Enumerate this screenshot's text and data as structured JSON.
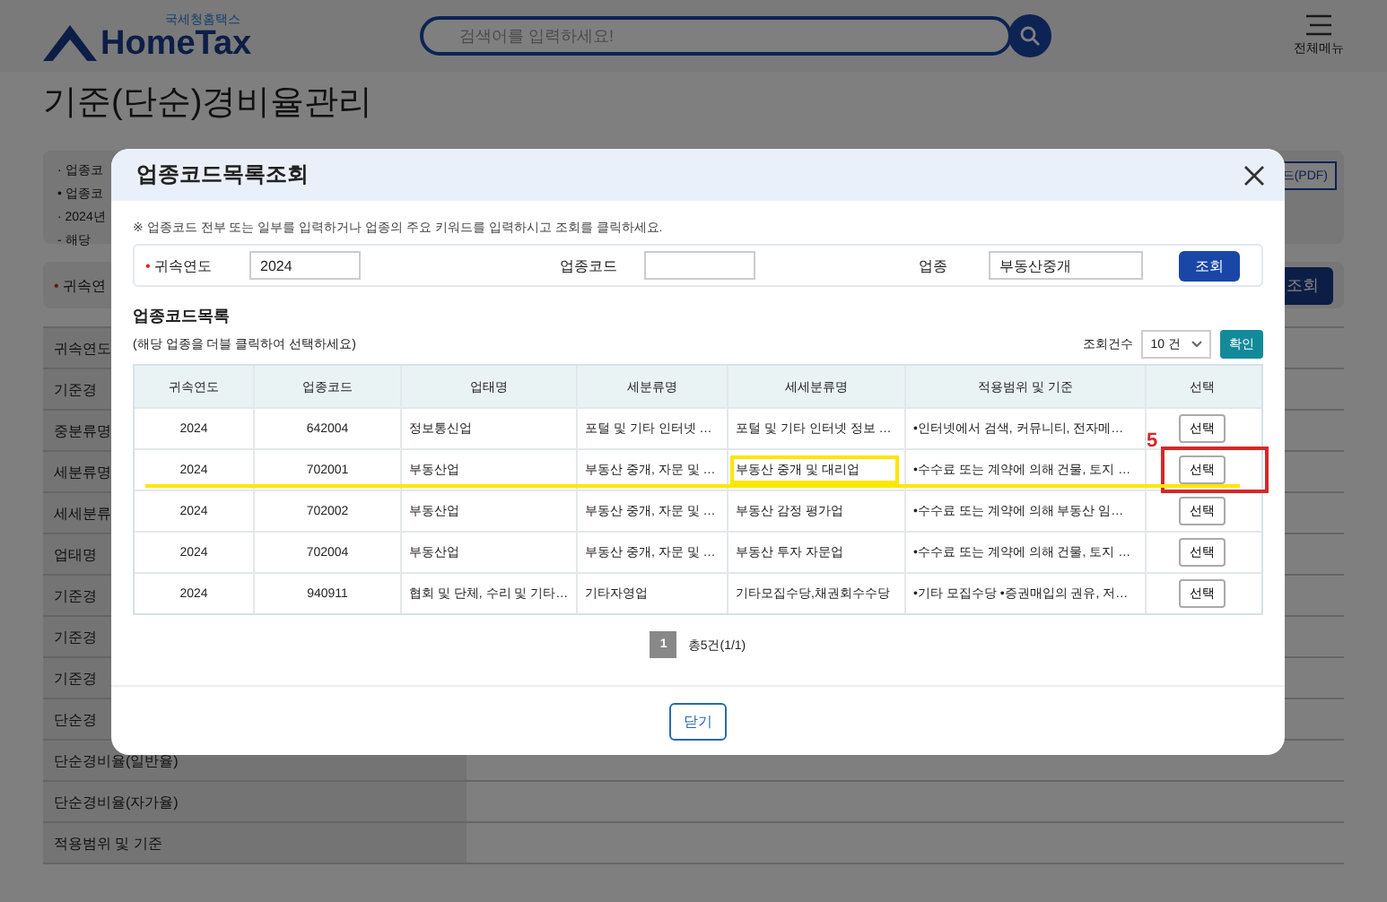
{
  "header": {
    "logo_sub": "국세청홈택스",
    "logo": "HomeTax",
    "search_placeholder": "검색어를 입력하세요!",
    "menu_label": "전체메뉴"
  },
  "page": {
    "title": "기준(단순)경비율관리",
    "info_lines": [
      "· 업종코",
      "• 업종코",
      "· 2024년",
      "- 해당"
    ],
    "pdf_button": "드(PDF)",
    "filter_marker": "•",
    "filter_label": "귀속연",
    "search_button": "조회",
    "table_labels": [
      "귀속연도",
      "기준경",
      "중분류명",
      "세분류명",
      "세세분류",
      "업태명",
      "기준경",
      "기준경",
      "기준경",
      "단순경",
      "단순경비율(일반율)",
      "단순경비율(자가율)",
      "적용범위 및 기준"
    ]
  },
  "modal": {
    "title": "업종코드목록조회",
    "note": "※ 업종코드 전부 또는 일부를 입력하거나 업종의 주요 키워드를 입력하시고 조회를 클릭하세요.",
    "fields": [
      {
        "marker": "•",
        "label": "귀속연도",
        "value": "2024"
      },
      {
        "label": "업종코드"
      },
      {
        "label": "업종",
        "value": "부동산중개"
      }
    ],
    "search_button": "조회",
    "list_title": "업종코드목록",
    "list_hint": "(해당 업종을 더블 클릭하여 선택하세요)",
    "count_label": "조회건수",
    "count_select": "10 건",
    "confirm_button": "확인",
    "columns": [
      "귀속연도",
      "업종코드",
      "업태명",
      "세분류명",
      "세세분류명",
      "적용범위 및 기준",
      "선택"
    ],
    "rows": [
      {
        "cells": [
          "2024",
          "642004",
          "정보통신업",
          "포털 및 기타 인터넷 …",
          "포털 및 기타 인터넷 정보 …",
          "•인터넷에서 검색, 커뮤니티, 전자메…"
        ],
        "button": "선택"
      },
      {
        "cells": [
          "2024",
          "702001",
          "부동산업",
          "부동산 중개, 자문 및 …",
          {
            "text": "부동산 중개 및 대리업",
            "box": {
              "color": "#ffe600"
            }
          },
          "•수수료 또는 계약에 의해 건물, 토지 …"
        ],
        "button": "선택",
        "underline": {
          "color": "#ffe600"
        },
        "button_box": {
          "color": "#d62828",
          "label": "5"
        }
      },
      {
        "cells": [
          "2024",
          "702002",
          "부동산업",
          "부동산 중개, 자문 및 …",
          "부동산 감정 평가업",
          "•수수료 또는 계약에 의해 부동산 임…"
        ],
        "button": "선택"
      },
      {
        "cells": [
          "2024",
          "702004",
          "부동산업",
          "부동산 중개, 자문 및 …",
          "부동산 투자 자문업",
          "•수수료 또는 계약에 의해 건물, 토지 …"
        ],
        "button": "선택"
      },
      {
        "cells": [
          "2024",
          "940911",
          "협회 및 단체, 수리 및 기타…",
          "기타자영업",
          "기타모집수당,채권회수수당",
          "•기타 모집수당 •증권매입의 권유, 저…"
        ],
        "button": "선택"
      }
    ],
    "pages": [
      {
        "label": "1",
        "selected": true
      }
    ],
    "total": "총5건(1/1)",
    "close_button": "닫기"
  }
}
